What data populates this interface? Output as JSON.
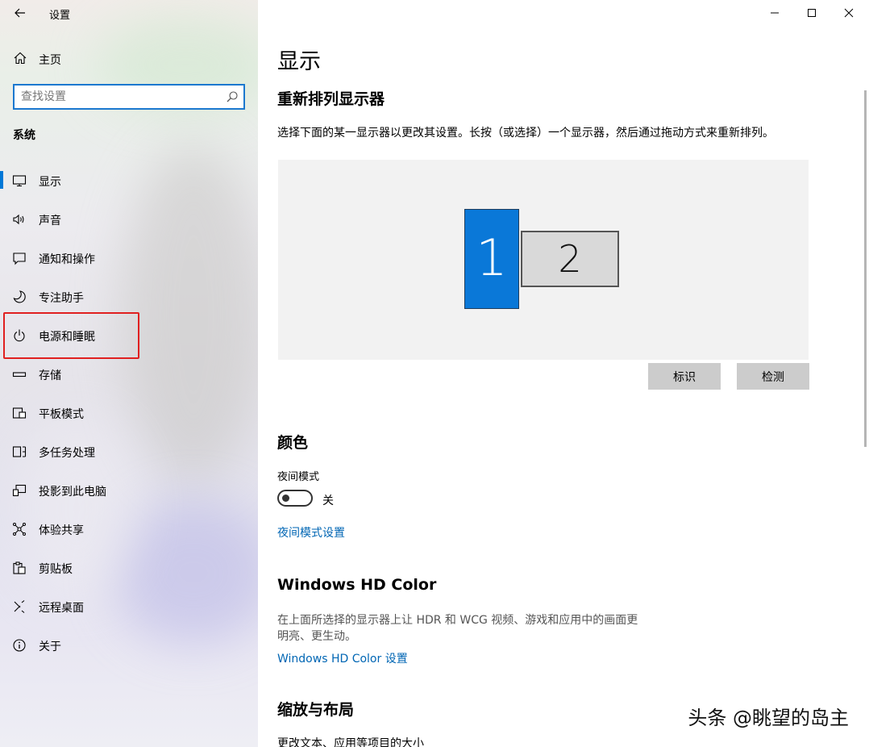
{
  "window": {
    "title": "设置"
  },
  "sidebar": {
    "home_label": "主页",
    "search_placeholder": "查找设置",
    "section_title": "系统",
    "items": [
      {
        "label": "显示",
        "icon": "monitor-icon"
      },
      {
        "label": "声音",
        "icon": "speaker-icon"
      },
      {
        "label": "通知和操作",
        "icon": "notification-icon"
      },
      {
        "label": "专注助手",
        "icon": "moon-icon"
      },
      {
        "label": "电源和睡眠",
        "icon": "power-icon"
      },
      {
        "label": "存储",
        "icon": "storage-icon"
      },
      {
        "label": "平板模式",
        "icon": "tablet-icon"
      },
      {
        "label": "多任务处理",
        "icon": "multitask-icon"
      },
      {
        "label": "投影到此电脑",
        "icon": "project-icon"
      },
      {
        "label": "体验共享",
        "icon": "share-icon"
      },
      {
        "label": "剪贴板",
        "icon": "clipboard-icon"
      },
      {
        "label": "远程桌面",
        "icon": "remote-icon"
      },
      {
        "label": "关于",
        "icon": "info-icon"
      }
    ]
  },
  "main": {
    "page_title": "显示",
    "arrange": {
      "title": "重新排列显示器",
      "description": "选择下面的某一显示器以更改其设置。长按（或选择）一个显示器，然后通过拖动方式来重新排列。",
      "monitor_1": "1",
      "monitor_2": "2",
      "identify_label": "标识",
      "detect_label": "检测"
    },
    "color": {
      "title": "颜色",
      "night_mode_label": "夜间模式",
      "night_mode_state": "关",
      "night_mode_link": "夜间模式设置"
    },
    "hd_color": {
      "title": "Windows HD Color",
      "description": "在上面所选择的显示器上让 HDR 和 WCG 视频、游戏和应用中的画面更明亮、更生动。",
      "link": "Windows HD Color 设置"
    },
    "scale": {
      "title": "缩放与布局",
      "description": "更改文本、应用等项目的大小"
    }
  },
  "watermark": "头条 @眺望的岛主",
  "colors": {
    "accent": "#0078d7",
    "highlight": "#e02020",
    "link": "#0066b4"
  }
}
